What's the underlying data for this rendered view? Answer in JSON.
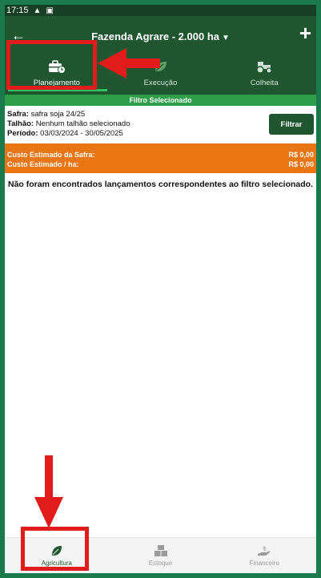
{
  "status_bar": {
    "time": "17:15",
    "icons": [
      "warning-icon",
      "image-icon"
    ]
  },
  "header": {
    "back_icon": "arrow-left-icon",
    "title": "Fazenda Agrare - 2.000 ha",
    "title_chevron": "chevron-down-icon",
    "add_icon": "plus-icon"
  },
  "tabs": [
    {
      "label": "Planejamento",
      "icon": "briefcase-clock-icon",
      "active": true
    },
    {
      "label": "Execução",
      "icon": "leaf-icon",
      "active": false
    },
    {
      "label": "Colheita",
      "icon": "tractor-icon",
      "active": false
    }
  ],
  "filter": {
    "strip_label": "Filtro Selecionado",
    "safra_key": "Safra:",
    "safra_value": "safra soja 24/25",
    "talhao_key": "Talhão:",
    "talhao_value": "Nenhum talhão selecionado",
    "periodo_key": "Período:",
    "periodo_value": "03/03/2024 - 30/05/2025",
    "button_label": "Filtrar"
  },
  "costs": {
    "safra_label": "Custo Estimado da Safra:",
    "safra_value": "R$ 0,00",
    "ha_label": "Custo Estimado / ha:",
    "ha_value": "R$ 0,00"
  },
  "empty_message": "Não foram encontrados lançamentos correspondentes ao filtro selecionado.",
  "bottom_nav": [
    {
      "label": "Agricultura",
      "icon": "leaf-icon",
      "active": true
    },
    {
      "label": "Estoque",
      "icon": "boxes-icon",
      "active": false
    },
    {
      "label": "Financeiro",
      "icon": "hand-dollar-icon",
      "active": false
    }
  ],
  "colors": {
    "frame": "#1a7a4c",
    "header": "#1f5630",
    "accent_green": "#2d9d49",
    "cost_orange": "#e97611",
    "annotation_red": "#e21b1b"
  }
}
